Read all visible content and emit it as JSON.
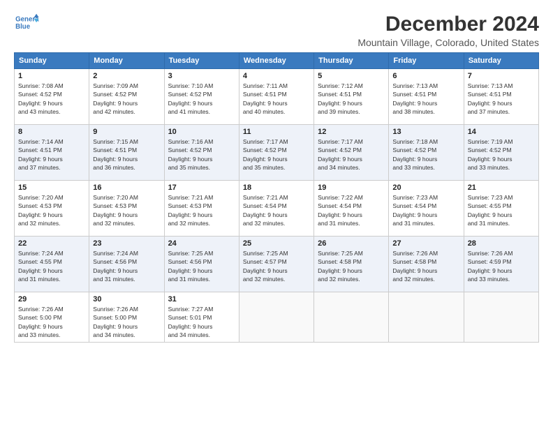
{
  "logo": {
    "line1": "General",
    "line2": "Blue"
  },
  "title": "December 2024",
  "subtitle": "Mountain Village, Colorado, United States",
  "weekdays": [
    "Sunday",
    "Monday",
    "Tuesday",
    "Wednesday",
    "Thursday",
    "Friday",
    "Saturday"
  ],
  "weeks": [
    [
      {
        "day": "1",
        "info": "Sunrise: 7:08 AM\nSunset: 4:52 PM\nDaylight: 9 hours\nand 43 minutes."
      },
      {
        "day": "2",
        "info": "Sunrise: 7:09 AM\nSunset: 4:52 PM\nDaylight: 9 hours\nand 42 minutes."
      },
      {
        "day": "3",
        "info": "Sunrise: 7:10 AM\nSunset: 4:52 PM\nDaylight: 9 hours\nand 41 minutes."
      },
      {
        "day": "4",
        "info": "Sunrise: 7:11 AM\nSunset: 4:51 PM\nDaylight: 9 hours\nand 40 minutes."
      },
      {
        "day": "5",
        "info": "Sunrise: 7:12 AM\nSunset: 4:51 PM\nDaylight: 9 hours\nand 39 minutes."
      },
      {
        "day": "6",
        "info": "Sunrise: 7:13 AM\nSunset: 4:51 PM\nDaylight: 9 hours\nand 38 minutes."
      },
      {
        "day": "7",
        "info": "Sunrise: 7:13 AM\nSunset: 4:51 PM\nDaylight: 9 hours\nand 37 minutes."
      }
    ],
    [
      {
        "day": "8",
        "info": "Sunrise: 7:14 AM\nSunset: 4:51 PM\nDaylight: 9 hours\nand 37 minutes."
      },
      {
        "day": "9",
        "info": "Sunrise: 7:15 AM\nSunset: 4:51 PM\nDaylight: 9 hours\nand 36 minutes."
      },
      {
        "day": "10",
        "info": "Sunrise: 7:16 AM\nSunset: 4:52 PM\nDaylight: 9 hours\nand 35 minutes."
      },
      {
        "day": "11",
        "info": "Sunrise: 7:17 AM\nSunset: 4:52 PM\nDaylight: 9 hours\nand 35 minutes."
      },
      {
        "day": "12",
        "info": "Sunrise: 7:17 AM\nSunset: 4:52 PM\nDaylight: 9 hours\nand 34 minutes."
      },
      {
        "day": "13",
        "info": "Sunrise: 7:18 AM\nSunset: 4:52 PM\nDaylight: 9 hours\nand 33 minutes."
      },
      {
        "day": "14",
        "info": "Sunrise: 7:19 AM\nSunset: 4:52 PM\nDaylight: 9 hours\nand 33 minutes."
      }
    ],
    [
      {
        "day": "15",
        "info": "Sunrise: 7:20 AM\nSunset: 4:53 PM\nDaylight: 9 hours\nand 32 minutes."
      },
      {
        "day": "16",
        "info": "Sunrise: 7:20 AM\nSunset: 4:53 PM\nDaylight: 9 hours\nand 32 minutes."
      },
      {
        "day": "17",
        "info": "Sunrise: 7:21 AM\nSunset: 4:53 PM\nDaylight: 9 hours\nand 32 minutes."
      },
      {
        "day": "18",
        "info": "Sunrise: 7:21 AM\nSunset: 4:54 PM\nDaylight: 9 hours\nand 32 minutes."
      },
      {
        "day": "19",
        "info": "Sunrise: 7:22 AM\nSunset: 4:54 PM\nDaylight: 9 hours\nand 31 minutes."
      },
      {
        "day": "20",
        "info": "Sunrise: 7:23 AM\nSunset: 4:54 PM\nDaylight: 9 hours\nand 31 minutes."
      },
      {
        "day": "21",
        "info": "Sunrise: 7:23 AM\nSunset: 4:55 PM\nDaylight: 9 hours\nand 31 minutes."
      }
    ],
    [
      {
        "day": "22",
        "info": "Sunrise: 7:24 AM\nSunset: 4:55 PM\nDaylight: 9 hours\nand 31 minutes."
      },
      {
        "day": "23",
        "info": "Sunrise: 7:24 AM\nSunset: 4:56 PM\nDaylight: 9 hours\nand 31 minutes."
      },
      {
        "day": "24",
        "info": "Sunrise: 7:25 AM\nSunset: 4:56 PM\nDaylight: 9 hours\nand 31 minutes."
      },
      {
        "day": "25",
        "info": "Sunrise: 7:25 AM\nSunset: 4:57 PM\nDaylight: 9 hours\nand 32 minutes."
      },
      {
        "day": "26",
        "info": "Sunrise: 7:25 AM\nSunset: 4:58 PM\nDaylight: 9 hours\nand 32 minutes."
      },
      {
        "day": "27",
        "info": "Sunrise: 7:26 AM\nSunset: 4:58 PM\nDaylight: 9 hours\nand 32 minutes."
      },
      {
        "day": "28",
        "info": "Sunrise: 7:26 AM\nSunset: 4:59 PM\nDaylight: 9 hours\nand 33 minutes."
      }
    ],
    [
      {
        "day": "29",
        "info": "Sunrise: 7:26 AM\nSunset: 5:00 PM\nDaylight: 9 hours\nand 33 minutes."
      },
      {
        "day": "30",
        "info": "Sunrise: 7:26 AM\nSunset: 5:00 PM\nDaylight: 9 hours\nand 34 minutes."
      },
      {
        "day": "31",
        "info": "Sunrise: 7:27 AM\nSunset: 5:01 PM\nDaylight: 9 hours\nand 34 minutes."
      },
      {
        "day": "",
        "info": ""
      },
      {
        "day": "",
        "info": ""
      },
      {
        "day": "",
        "info": ""
      },
      {
        "day": "",
        "info": ""
      }
    ]
  ]
}
